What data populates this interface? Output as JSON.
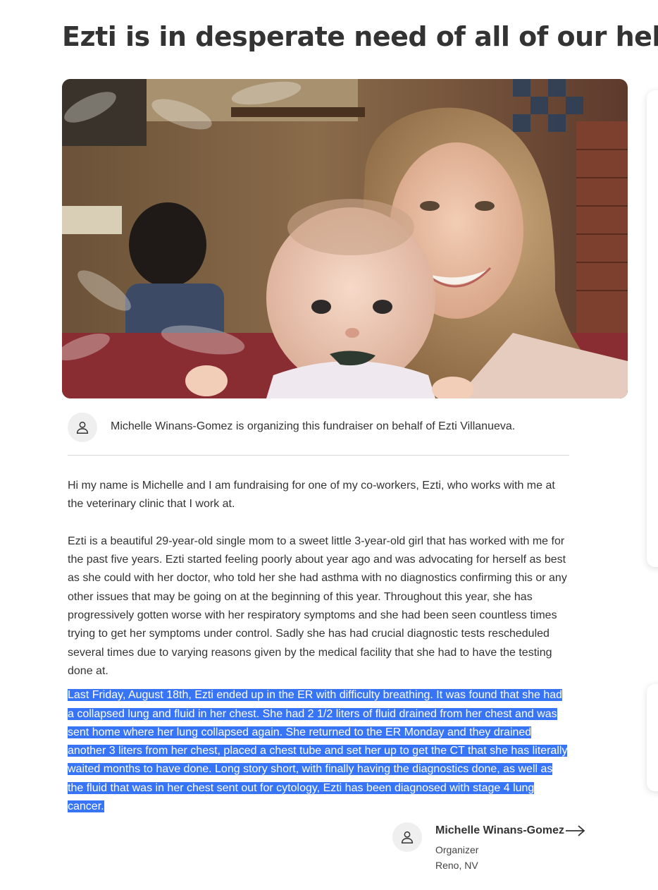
{
  "campaign": {
    "title": "Ezti is in desperate need of all of our help",
    "hero_image_alt": "Woman holding baby at restaurant"
  },
  "organizer_line": "Michelle Winans-Gomez is organizing this fundraiser on behalf of Ezti Villanueva.",
  "story": {
    "paragraph_1": "Hi my name is Michelle and I am fundraising for one of my co-workers, Ezti, who works with me at the veterinary clinic that I work at.",
    "paragraph_2": "Ezti is a beautiful 29-year-old single mom to a sweet little 3-year-old girl that has worked with me for the past five years. Ezti started feeling poorly about year ago and was advocating for herself as best as she could with her doctor, who told her she had asthma with no diagnostics confirming this or any other issues that may be going on at the beginning of this year. Throughout this year, she has progressively gotten worse with her respiratory symptoms and she had been seen countless times trying to get her symptoms under control. Sadly she has had crucial diagnostic tests rescheduled several times due to varying reasons given by the medical facility that she had to have the testing done at.",
    "paragraph_3_highlighted": "Last Friday, August 18th, Ezti ended up in the ER with difficulty breathing. It was found that she had a collapsed lung and fluid in her chest. She had 2 1/2 liters of fluid drained from her chest and was sent home where her lung collapsed again. She returned to the ER Monday and they drained another 3 liters from her chest, placed a chest tube and set her up to get the CT that she has literally waited months to have done. Long story short, with finally having the diagnostics done, as well as the fluid that was in her chest sent out for cytology, Ezti has been diagnosed with stage 4 lung cancer."
  },
  "organizer_card": {
    "name": "Michelle Winans-Gomez",
    "role": "Organizer",
    "location": "Reno, NV"
  },
  "colors": {
    "text": "#333333",
    "selection_highlight": "#3874f6",
    "avatar_bg": "#efefef",
    "divider": "#d6d6d6"
  },
  "icons": {
    "avatar": "user-outline-icon",
    "organizer_link": "arrow-right-icon"
  }
}
